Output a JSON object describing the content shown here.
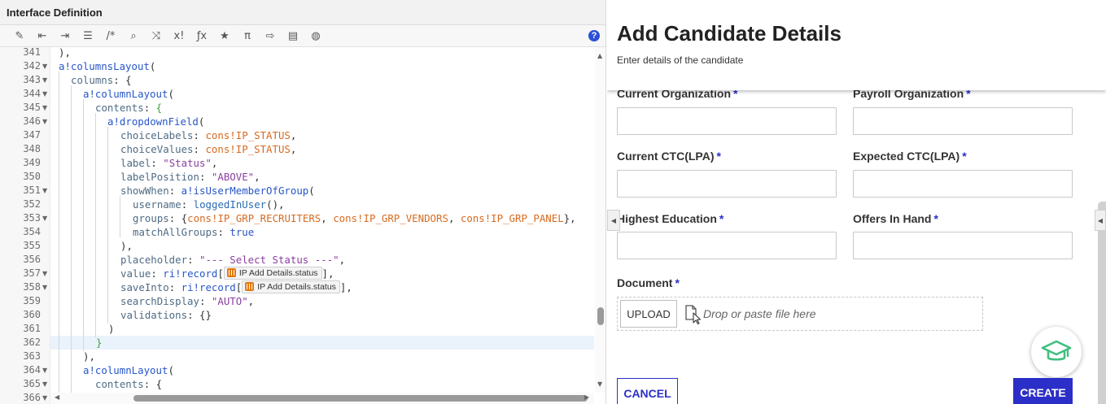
{
  "editor": {
    "title": "Interface Definition",
    "toolbar_icons": [
      "magic-wand-icon",
      "outdent-icon",
      "indent-icon",
      "format-icon",
      "comment-icon",
      "search-icon",
      "shuffle-icon",
      "factorial-icon",
      "function-icon",
      "star-icon",
      "pi-icon",
      "export-icon",
      "rules-icon",
      "globe-icon"
    ],
    "toolbar_glyphs": [
      "✎",
      "⇤",
      "⇥",
      "☰",
      "/*",
      "⌕",
      "⤨",
      "x!",
      "ƒx",
      "★",
      "π",
      "⇨",
      "▤",
      "◍"
    ],
    "help_label": "?",
    "line_numbers": [
      "341",
      "342",
      "343",
      "344",
      "345",
      "346",
      "347",
      "348",
      "349",
      "350",
      "351",
      "352",
      "353",
      "354",
      "355",
      "356",
      "357",
      "358",
      "359",
      "360",
      "361",
      "362",
      "363",
      "364",
      "365",
      "366"
    ],
    "tokens": {
      "status": "IP Add Details.status"
    }
  },
  "form": {
    "title": "Add Candidate Details",
    "subtitle": "Enter details of the candidate",
    "required_mark": "*",
    "fields": {
      "current_org": "Current Organization",
      "payroll_org": "Payroll Organization",
      "current_ctc": "Current CTC(LPA)",
      "expected_ctc": "Expected CTC(LPA)",
      "highest_edu": "Highest Education",
      "offers": "Offers In Hand",
      "document": "Document"
    },
    "upload_label": "UPLOAD",
    "drop_hint": "Drop or paste file here",
    "cancel_label": "CANCEL",
    "create_label": "CREATE"
  },
  "colors": {
    "accent": "#2c2fc7",
    "keyword": "#2756c8",
    "constant": "#d76a1f",
    "string": "#8a3fa0",
    "badge": "#3fbf7f"
  }
}
